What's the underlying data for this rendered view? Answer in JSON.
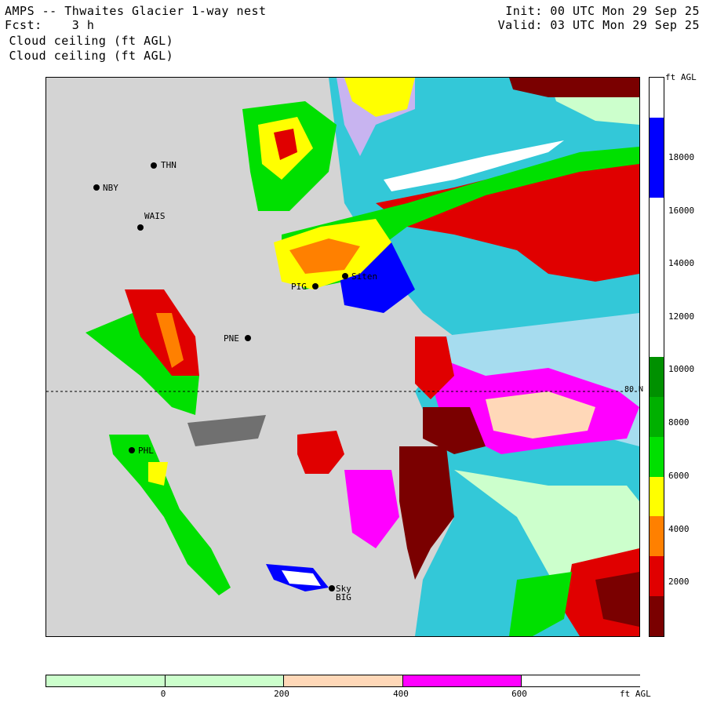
{
  "header": {
    "title": "AMPS -- Thwaites Glacier 1-way nest",
    "forecast": "Fcst:    3 h",
    "field_line1": " Cloud ceiling (ft AGL)",
    "field_line2": " Cloud ceiling (ft AGL)",
    "init": "Init: 00 UTC Mon 29 Sep 25",
    "valid": "Valid: 03 UTC Mon 29 Sep 25"
  },
  "map": {
    "stations": [
      {
        "id": "THN",
        "label": "THN"
      },
      {
        "id": "NBY",
        "label": "NBY"
      },
      {
        "id": "WAIS",
        "label": "WAIS"
      },
      {
        "id": "PIG",
        "label": "PIG"
      },
      {
        "id": "Siten",
        "label": "Siten"
      },
      {
        "id": "PNE",
        "label": "PNE"
      },
      {
        "id": "PHL",
        "label": "PHL"
      },
      {
        "id": "Sky",
        "label": "Sky"
      },
      {
        "id": "BIG",
        "label": "BIG"
      }
    ],
    "latitude_label": "80 N"
  },
  "colorbar_vertical": {
    "unit": "ft AGL",
    "ticks": [
      "2000",
      "4000",
      "6000",
      "8000",
      "10000",
      "12000",
      "14000",
      "16000",
      "18000"
    ],
    "colors": [
      "#7a0000",
      "#e00000",
      "#ff8000",
      "#ffff00",
      "#00e000",
      "#00b000",
      "#009000",
      "#ffffff",
      "#ffffff",
      "#ffffff",
      "#ffffff",
      "#0000ff",
      "#0000ff",
      "#ffffff"
    ]
  },
  "colorbar_horizontal": {
    "unit": "ft AGL",
    "ticks": [
      "0",
      "200",
      "400",
      "600"
    ],
    "colors": [
      "#ccffcc",
      "#ccffcc",
      "#ffd8b8",
      "#ff00ff",
      "#ffffff"
    ]
  },
  "colors": {
    "terrain": "#d4d4d4",
    "ocean": "#33c8d8",
    "light_ocean": "#a6dcef",
    "pale_green": "#ccffcc"
  }
}
